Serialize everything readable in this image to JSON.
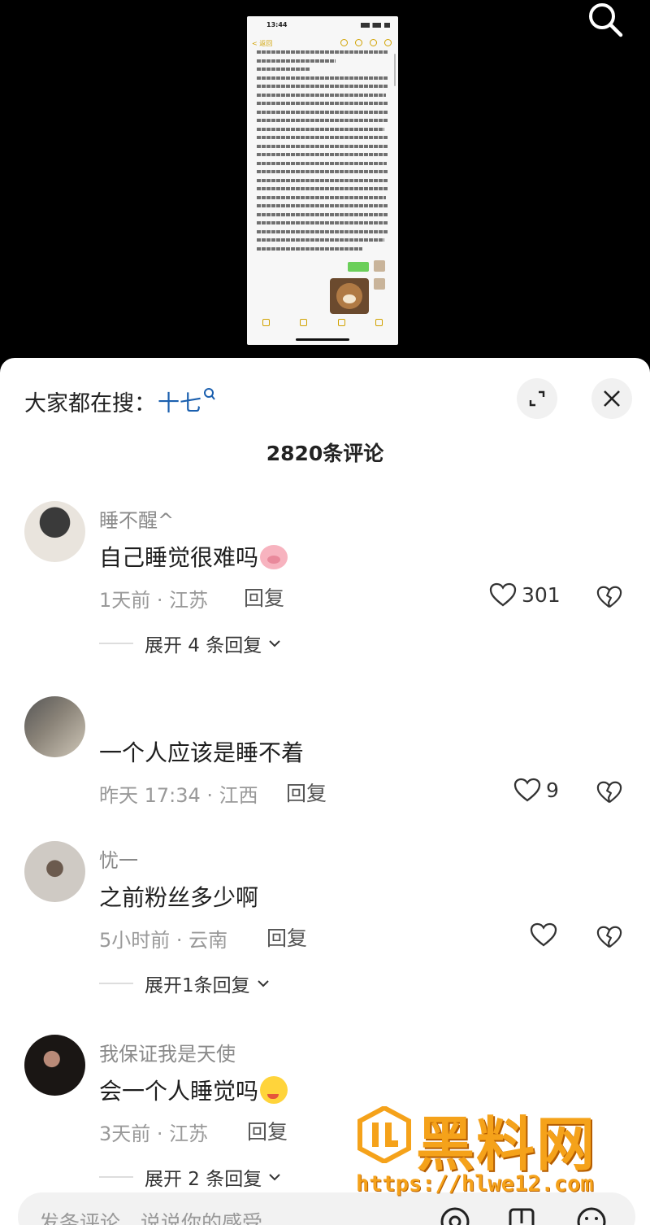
{
  "video": {
    "status_time": "13:44",
    "back_label": "< 返回"
  },
  "sheet": {
    "search_prefix": "大家都在搜：",
    "search_keyword": "十七",
    "comment_count_title": "2820条评论"
  },
  "comments": [
    {
      "username": "睡不醒^",
      "text": "自己睡觉很难吗",
      "emoji": "pig-face",
      "meta": "1天前 · 江苏",
      "reply_label": "回复",
      "likes": "301",
      "expand_label": "展开 4 条回复"
    },
    {
      "username": "",
      "text": "一个人应该是睡不着",
      "meta": "昨天 17:34 · 江西",
      "reply_label": "回复",
      "likes": "9"
    },
    {
      "username": "忧一",
      "text": "之前粉丝多少啊",
      "meta": "5小时前 · 云南",
      "reply_label": "回复",
      "likes": "",
      "expand_label": "展开1条回复"
    },
    {
      "username": "我保证我是天使",
      "text": "会一个人睡觉吗",
      "emoji": "drooling-face",
      "meta": "3天前 · 江苏",
      "reply_label": "回复",
      "likes": "",
      "expand_label": "展开 2 条回复"
    }
  ],
  "input": {
    "placeholder": "发条评论，说说你的感受"
  },
  "watermark": {
    "brand": "黑料网",
    "url": "https://hlwe12.com"
  },
  "colors": {
    "keyword_blue": "#1a5fae",
    "watermark_orange": "#f5a21a"
  }
}
